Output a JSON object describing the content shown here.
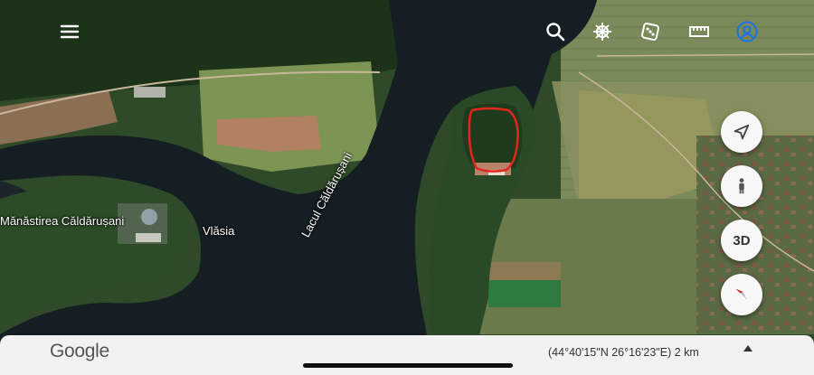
{
  "app": {
    "logo_text": "Google"
  },
  "toolbar": {
    "menu_icon": "menu-icon",
    "search_icon": "search-icon",
    "voyager_icon": "ship-wheel-icon",
    "feeling_lucky_icon": "dice-icon",
    "measure_icon": "ruler-icon",
    "profile_icon": "account-icon"
  },
  "controls": {
    "my_location_icon": "navigation-arrow-icon",
    "street_view_icon": "pegman-icon",
    "three_d_label": "3D",
    "compass_icon": "compass-icon"
  },
  "map_labels": {
    "monastery": "Mănăstirea Căldărușani",
    "village": "Vlăsia",
    "lake": "Lacul Căldărușani"
  },
  "status": {
    "coordinates": "(44°40'15\"N 26°16'23\"E) 2 km"
  },
  "colors": {
    "water": "#141d22",
    "forest": "#243b22",
    "field": "#6f8f4e",
    "highlight": "#e2261c",
    "profile_accent": "#1a73e8"
  }
}
